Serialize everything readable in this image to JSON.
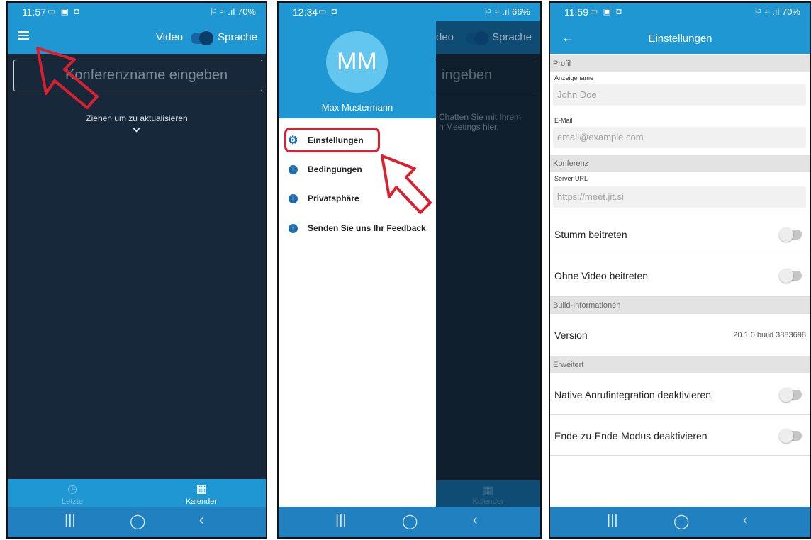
{
  "phone1": {
    "status": {
      "time": "11:57",
      "right": "⚐ ≈ .ıl 70%"
    },
    "header": {
      "video_label": "Video",
      "language_label": "Sprache"
    },
    "conference_input": {
      "placeholder": "Konferenzname eingeben"
    },
    "pull_text": "Ziehen um zu aktualisieren",
    "tabs": [
      {
        "label": "Letzte",
        "icon": "history-icon"
      },
      {
        "label": "Kalender",
        "icon": "calendar-icon"
      }
    ]
  },
  "phone2": {
    "status": {
      "time": "12:34",
      "right": "⚐ ≈ .ıl 66%"
    },
    "overlay": {
      "header_video": "deo",
      "header_language": "Sprache",
      "input_text": "ingeben",
      "hint_line1": "Chatten Sie mit Ihrem",
      "hint_line2": "n Meetings hier.",
      "tab_label": "Kalender"
    },
    "drawer": {
      "avatar_initials": "MM",
      "user_name": "Max Mustermann",
      "items": [
        {
          "label": "Einstellungen",
          "icon": "gear-icon"
        },
        {
          "label": "Bedingungen",
          "icon": "info-icon"
        },
        {
          "label": "Privatsphäre",
          "icon": "info-icon"
        },
        {
          "label": "Senden Sie uns Ihr Feedback",
          "icon": "info-icon"
        }
      ]
    }
  },
  "phone3": {
    "status": {
      "time": "11:59",
      "right": "⚐ ≈ .ıl 70%"
    },
    "title": "Einstellungen",
    "sections": {
      "profile": "Profil",
      "conference": "Konferenz",
      "build": "Build-Informationen",
      "advanced": "Erweitert"
    },
    "fields": {
      "display_name_label": "Anzeigename",
      "display_name_placeholder": "John Doe",
      "email_label": "E-Mail",
      "email_placeholder": "email@example.com",
      "server_label": "Server URL",
      "server_placeholder": "https://meet.jit.si"
    },
    "toggles": {
      "join_muted": "Stumm beitreten",
      "join_no_video": "Ohne Video beitreten",
      "disable_call_integration": "Native Anrufintegration deaktivieren",
      "disable_e2e": "Ende-zu-Ende-Modus deaktivieren"
    },
    "version": {
      "label": "Version",
      "value": "20.1.0 build 3883698"
    }
  },
  "colors": {
    "accent": "#1f97d2",
    "dark_background": "#17283a",
    "navbar": "#2180c0",
    "highlight": "#d92030"
  }
}
